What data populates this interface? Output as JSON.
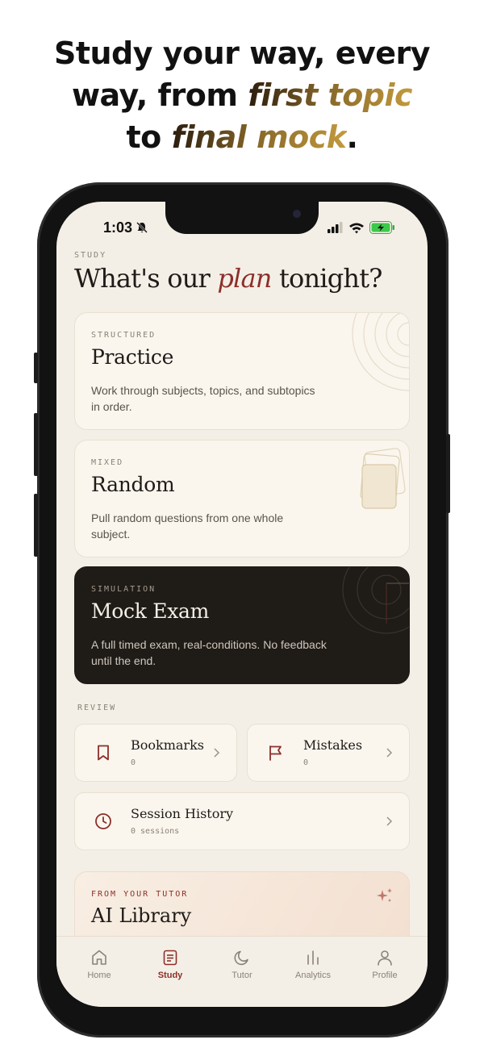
{
  "headline": {
    "line1": "Study your way, every",
    "line2_pre": "way, from ",
    "line2_accent": "first topic",
    "line3_pre": "to ",
    "line3_accent": "final mock",
    "line3_post": "."
  },
  "status": {
    "time": "1:03"
  },
  "page": {
    "eyebrow": "STUDY",
    "title_pre": "What's our ",
    "title_em": "plan",
    "title_post": " tonight?"
  },
  "modes": [
    {
      "eyebrow": "STRUCTURED",
      "title": "Practice",
      "desc": "Work through subjects, topics, and subtopics in order."
    },
    {
      "eyebrow": "MIXED",
      "title": "Random",
      "desc": "Pull random questions from one whole subject."
    },
    {
      "eyebrow": "SIMULATION",
      "title": "Mock Exam",
      "desc": "A full timed exam, real-conditions. No feedback until the end."
    }
  ],
  "review": {
    "label": "REVIEW",
    "bookmarks": {
      "name": "Bookmarks",
      "count": "0"
    },
    "mistakes": {
      "name": "Mistakes",
      "count": "0"
    },
    "history": {
      "name": "Session History",
      "count": "0 sessions"
    }
  },
  "tutor": {
    "eyebrow": "FROM YOUR TUTOR",
    "title": "AI Library"
  },
  "tabs": [
    {
      "label": "Home",
      "icon": "home-icon"
    },
    {
      "label": "Study",
      "icon": "study-icon",
      "active": true
    },
    {
      "label": "Tutor",
      "icon": "moon-icon"
    },
    {
      "label": "Analytics",
      "icon": "analytics-icon"
    },
    {
      "label": "Profile",
      "icon": "profile-icon"
    }
  ],
  "colors": {
    "accent": "#8c2f2a",
    "background": "#f4efe6",
    "card": "#faf6ee",
    "dark_card": "#1f1b17"
  }
}
